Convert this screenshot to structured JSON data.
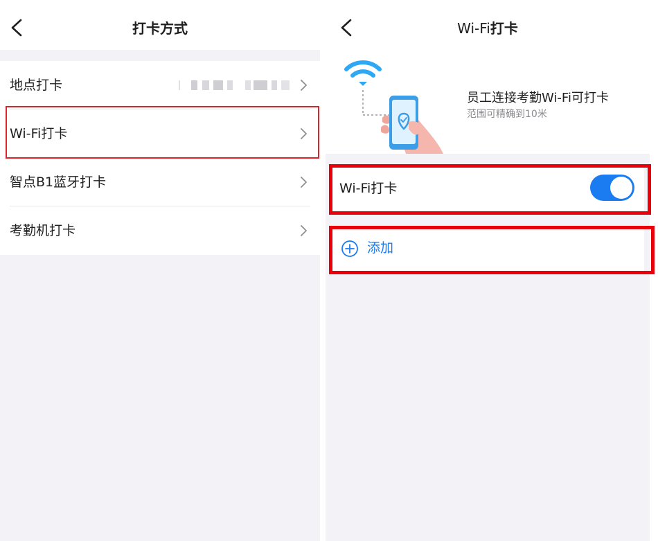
{
  "left_screen": {
    "title": "打卡方式",
    "items": [
      {
        "label": "地点打卡",
        "has_blurred_value": true
      },
      {
        "label": "Wi-Fi打卡",
        "highlighted": true
      },
      {
        "label": "智点B1蓝牙打卡"
      },
      {
        "label": "考勤机打卡"
      }
    ]
  },
  "right_screen": {
    "title_prefix": "Wi-Fi",
    "title_suffix": "打卡",
    "hero": {
      "title": "员工连接考勤Wi-Fi可打卡",
      "subtitle": "范围可精确到10米"
    },
    "toggle": {
      "label": "Wi-Fi打卡",
      "on": true
    },
    "add": {
      "label": "添加"
    }
  },
  "colors": {
    "accent": "#1a7cf0",
    "highlight_border": "#e8000a",
    "background": "#f3f3f7"
  }
}
